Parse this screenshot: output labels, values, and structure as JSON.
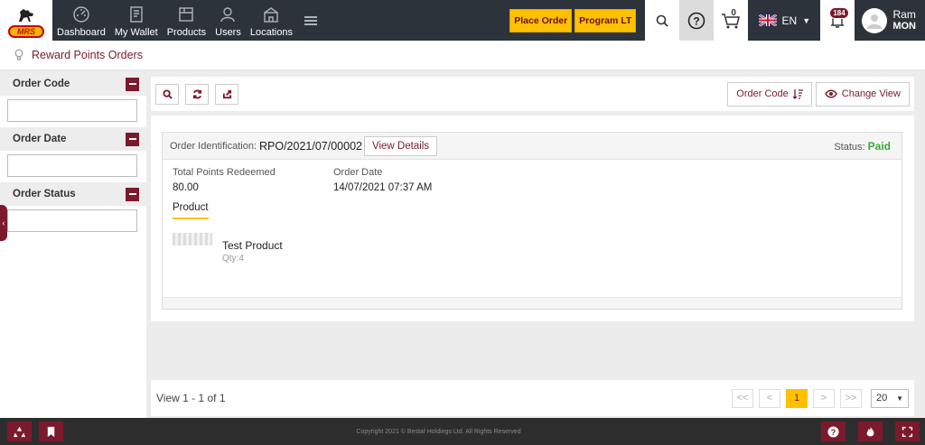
{
  "nav": {
    "items": [
      {
        "label": "Dashboard",
        "icon": "dashboard-icon"
      },
      {
        "label": "My Wallet",
        "icon": "wallet-icon"
      },
      {
        "label": "Products",
        "icon": "products-icon"
      },
      {
        "label": "Users",
        "icon": "users-icon"
      },
      {
        "label": "Locations",
        "icon": "locations-icon"
      }
    ],
    "logo_text": "MRS",
    "place_order": "Place Order",
    "program_lt": "Program LT",
    "cart_count": "0",
    "language": "EN",
    "notification_count": "184",
    "user_name": "Ram",
    "user_sub": "MON"
  },
  "breadcrumb": {
    "title": "Reward Points Orders"
  },
  "filters": [
    {
      "label": "Order Code",
      "value": ""
    },
    {
      "label": "Order Date",
      "value": ""
    },
    {
      "label": "Order Status",
      "value": ""
    }
  ],
  "toolbar": {
    "sort_label": "Order Code",
    "change_view": "Change View"
  },
  "order": {
    "id_label": "Order Identification:",
    "id": "RPO/2021/07/00002",
    "view_details": "View Details",
    "status_label": "Status:",
    "status": "Paid",
    "points_label": "Total Points Redeemed",
    "points": "80.00",
    "date_label": "Order Date",
    "date": "14/07/2021 07:37 AM",
    "product_tab": "Product",
    "product_name": "Test Product",
    "product_qty": "Qty:4"
  },
  "pager": {
    "text": "View 1 - 1 of 1",
    "current": "1",
    "page_size": "20",
    "first": "<<",
    "prev": "<",
    "next": ">",
    "last": ">>"
  },
  "footer": {
    "copyright": "Copyright 2021 © Bestaf Holdings Ltd. All Rights Reserved"
  },
  "colors": {
    "brand": "#7b1a2c",
    "accent": "#ffc000",
    "nav_bg": "#2d333b",
    "status_paid": "#3aa935"
  }
}
